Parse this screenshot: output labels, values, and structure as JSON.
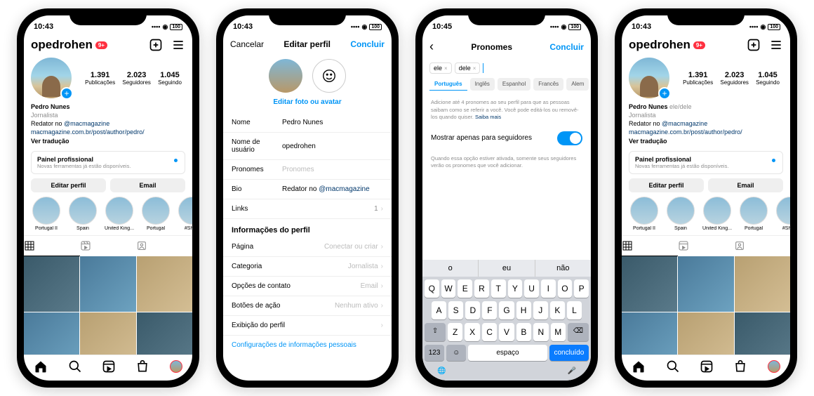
{
  "status": {
    "time1": "10:43",
    "time2": "10:43",
    "time3": "10:45",
    "time4": "10:43",
    "battery": "100"
  },
  "profile": {
    "username": "opedrohen",
    "badge": "9+",
    "stats": {
      "posts_n": "1.391",
      "posts_l": "Publicações",
      "followers_n": "2.023",
      "followers_l": "Seguidores",
      "following_n": "1.045",
      "following_l": "Seguindo"
    },
    "display_name": "Pedro Nunes",
    "pronouns_inline": "ele/dele",
    "category": "Jornalista",
    "bio_prefix": " Redator no ",
    "bio_mention": "@macmagazine",
    "bio_url": "macmagazine.com.br/post/author/pedro/",
    "translate": "Ver tradução",
    "panel_title": "Painel profissional",
    "panel_sub": "Novas ferramentas já estão disponíveis.",
    "edit_btn": "Editar perfil",
    "email_btn": "Email",
    "highlights": [
      "Portugal II",
      "Spain",
      "United King...",
      "Portugal",
      "#Shoto"
    ],
    "highlights4": [
      "Portugal II",
      "Spain",
      "United King...",
      "Portugal",
      "#Shoto"
    ]
  },
  "edit": {
    "cancel": "Cancelar",
    "title": "Editar perfil",
    "done": "Concluir",
    "photo_link": "Editar foto ou avatar",
    "rows": {
      "name_l": "Nome",
      "name_v": "Pedro Nunes",
      "user_l": "Nome de usuário",
      "user_v": "opedrohen",
      "pron_l": "Pronomes",
      "pron_ph": "Pronomes",
      "bio_l": "Bio",
      "bio_v_prefix": " Redator no ",
      "bio_v_tag": "@macmagazine",
      "links_l": "Links",
      "links_v": "1"
    },
    "section": "Informações do perfil",
    "page_l": "Página",
    "page_v": "Conectar ou criar",
    "cat_l": "Categoria",
    "cat_v": "Jornalista",
    "contact_l": "Opções de contato",
    "contact_v": "Email",
    "action_l": "Botões de ação",
    "action_v": "Nenhum ativo",
    "display_l": "Exibição do perfil",
    "config": "Configurações de informações pessoais"
  },
  "pronouns": {
    "title": "Pronomes",
    "done": "Concluir",
    "tokens": [
      "ele",
      "dele"
    ],
    "langs": [
      "Português",
      "Inglês",
      "Espanhol",
      "Francês",
      "Alem"
    ],
    "help": "Adicione até 4 pronomes ao seu perfil para que as pessoas saibam como se referir a você. Você pode editá-los ou removê-los quando quiser.",
    "help_more": "Saiba mais",
    "toggle_label": "Mostrar apenas para seguidores",
    "toggle_help": "Quando essa opção estiver ativada, somente seus seguidores verão os pronomes que você adicionar.",
    "suggestions": [
      "o",
      "eu",
      "não"
    ],
    "space": "espaço",
    "kbd_done": "concluído",
    "num_key": "123"
  }
}
